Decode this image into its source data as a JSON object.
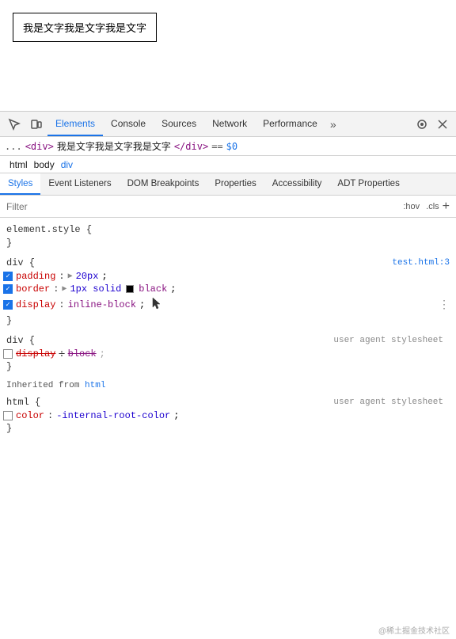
{
  "preview": {
    "text": "我是文字我是文字我是文字"
  },
  "devtools": {
    "tabs": [
      {
        "label": "Elements",
        "active": true
      },
      {
        "label": "Console",
        "active": false
      },
      {
        "label": "Sources",
        "active": false
      },
      {
        "label": "Network",
        "active": false
      },
      {
        "label": "Performance",
        "active": false
      }
    ],
    "more_label": "»",
    "selected_element": {
      "prefix": "...",
      "open_tag": "<div>",
      "text": "我是文字我是文字我是文字",
      "close_tag": "</div>",
      "eq": "==",
      "dollar": "$0"
    },
    "breadcrumb": [
      "html",
      "body",
      "div"
    ],
    "styles_tabs": [
      {
        "label": "Styles",
        "active": true
      },
      {
        "label": "Event Listeners",
        "active": false
      },
      {
        "label": "DOM Breakpoints",
        "active": false
      },
      {
        "label": "Properties",
        "active": false
      },
      {
        "label": "Accessibility",
        "active": false
      },
      {
        "label": "ADT Properties",
        "active": false
      }
    ],
    "filter": {
      "placeholder": "Filter",
      "hov_label": ":hov",
      "cls_label": ".cls",
      "plus_label": "+"
    },
    "style_blocks": [
      {
        "id": "element_style",
        "selector": "element.style {",
        "source": "",
        "rules": [],
        "close": "}"
      },
      {
        "id": "div_block",
        "selector": "div {",
        "source": "test.html:3",
        "rules": [
          {
            "checked": true,
            "prop": "padding",
            "colon": ":",
            "arrow": true,
            "value": "20px",
            "semi": ";",
            "strikethrough": false
          },
          {
            "checked": true,
            "prop": "border",
            "colon": ":",
            "arrow": true,
            "value": "1px solid",
            "color": "black",
            "colorSwatch": true,
            "semi": ";",
            "strikethrough": false
          },
          {
            "checked": true,
            "prop": "display",
            "colon": ":",
            "arrow": false,
            "value": "inline-block",
            "semi": ";",
            "strikethrough": false
          }
        ],
        "close": "}"
      },
      {
        "id": "div_ua",
        "selector": "div {",
        "source": "user agent stylesheet",
        "rules": [
          {
            "checked": false,
            "prop": "display",
            "colon": ":",
            "arrow": false,
            "value": "block",
            "semi": ";",
            "strikethrough": true
          }
        ],
        "close": "}"
      },
      {
        "id": "inherited",
        "label": "Inherited from",
        "tag": "html"
      },
      {
        "id": "html_ua",
        "selector": "html {",
        "source": "user agent stylesheet",
        "rules": [
          {
            "checked": false,
            "prop": "color",
            "colon": ":",
            "arrow": false,
            "value": "-internal-root-color",
            "semi": ";",
            "strikethrough": false
          }
        ],
        "close": "}"
      }
    ],
    "watermark": "@稀土掘金技术社区"
  }
}
